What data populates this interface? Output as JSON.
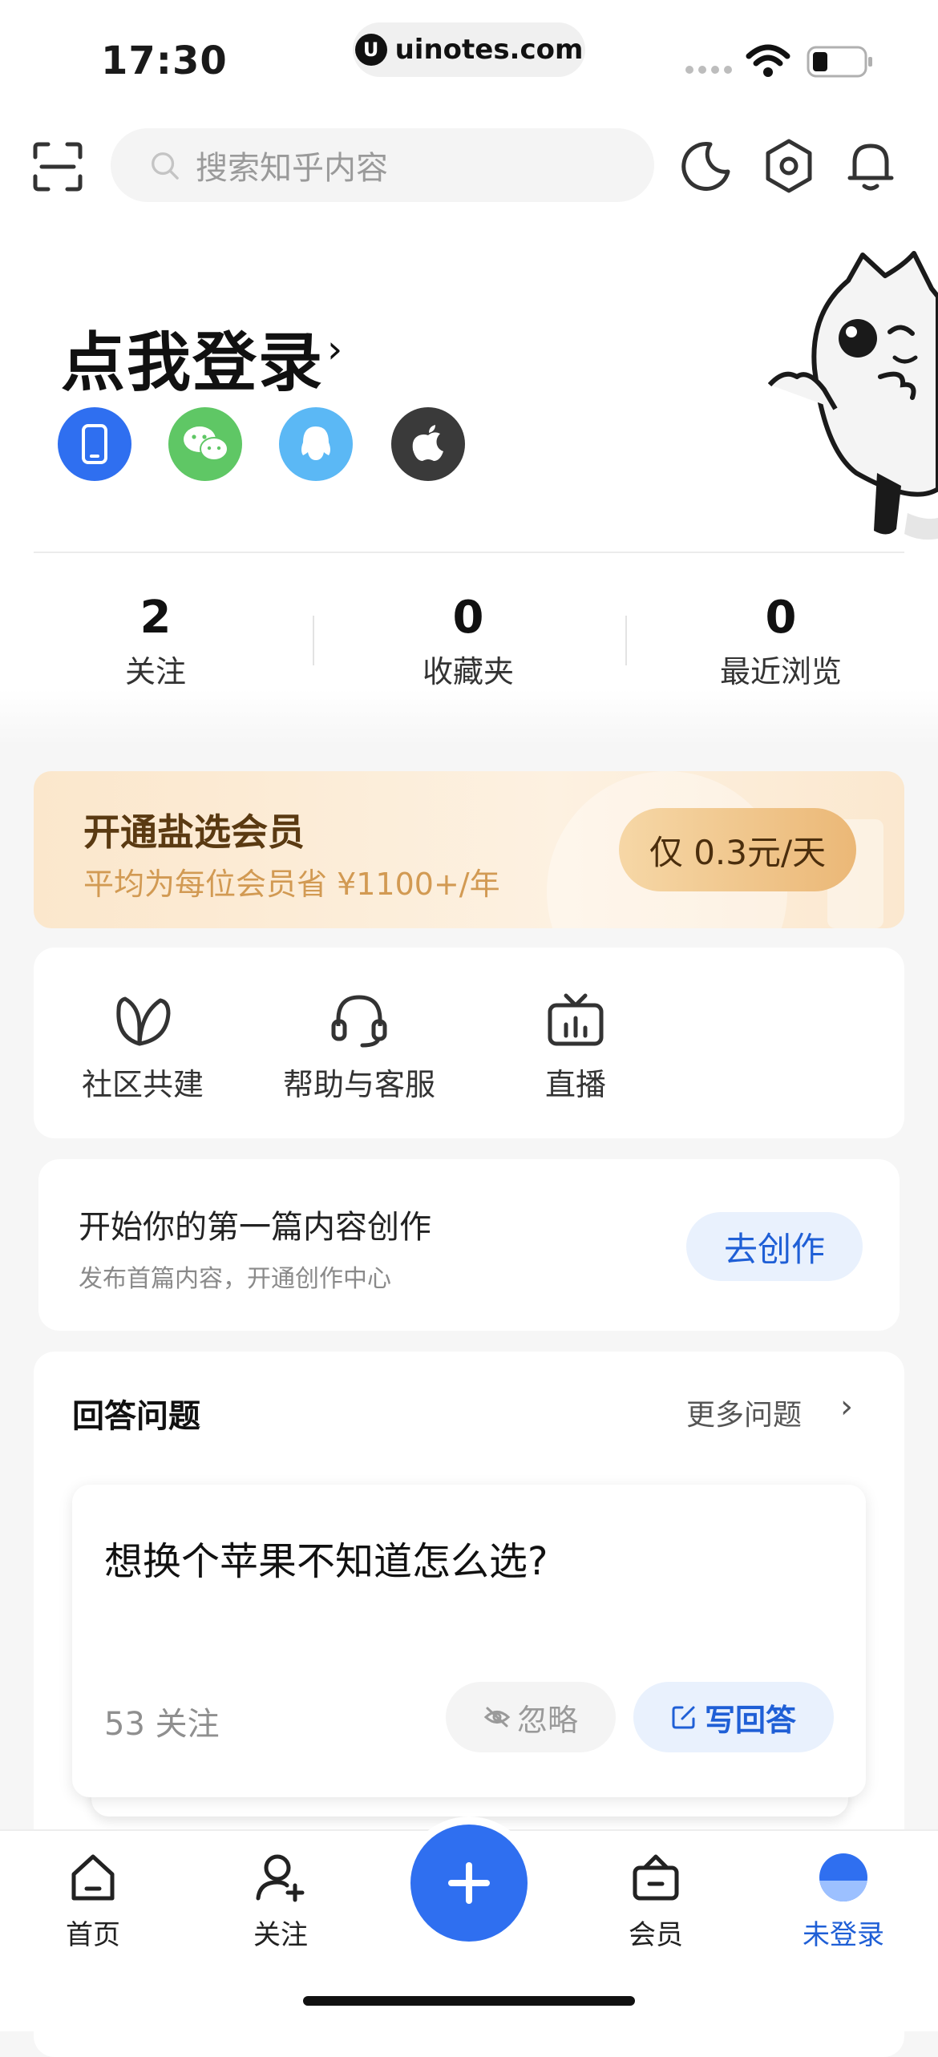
{
  "status_bar": {
    "time": "17:30",
    "url": "uinotes.com",
    "url_logo": "U"
  },
  "header": {
    "search_placeholder": "搜索知乎内容"
  },
  "login": {
    "title": "点我登录",
    "chevron": "›",
    "methods": [
      "phone-icon",
      "wechat-icon",
      "qq-icon",
      "apple-icon"
    ]
  },
  "stats": [
    {
      "value": "2",
      "label": "关注"
    },
    {
      "value": "0",
      "label": "收藏夹"
    },
    {
      "value": "0",
      "label": "最近浏览"
    }
  ],
  "vip": {
    "title": "开通盐选会员",
    "subtitle": "平均为每位会员省 ¥1100+/年",
    "button": "仅 0.3元/天"
  },
  "quick_menu": [
    {
      "label": "社区共建",
      "icon": "leaf-icon"
    },
    {
      "label": "帮助与客服",
      "icon": "headset-icon"
    },
    {
      "label": "直播",
      "icon": "tv-icon"
    }
  ],
  "create": {
    "title": "开始你的第一篇内容创作",
    "subtitle": "发布首篇内容，开通创作中心",
    "button": "去创作"
  },
  "answer": {
    "title": "回答问题",
    "more": "更多问题",
    "question": {
      "title": "想换个苹果不知道怎么选?",
      "followers": "53 关注",
      "ignore": "忽略",
      "write": "写回答"
    }
  },
  "tabbar": {
    "items": [
      {
        "label": "首页",
        "icon": "home-icon"
      },
      {
        "label": "关注",
        "icon": "follow-icon"
      },
      {
        "label": "会员",
        "icon": "vip-icon"
      },
      {
        "label": "未登录",
        "icon": "avatar-icon"
      }
    ],
    "fab_icon": "plus-icon"
  },
  "colors": {
    "accent": "#2f6ff0",
    "vip_gold": "#ebb877",
    "link_blue": "#1f5fd6"
  }
}
